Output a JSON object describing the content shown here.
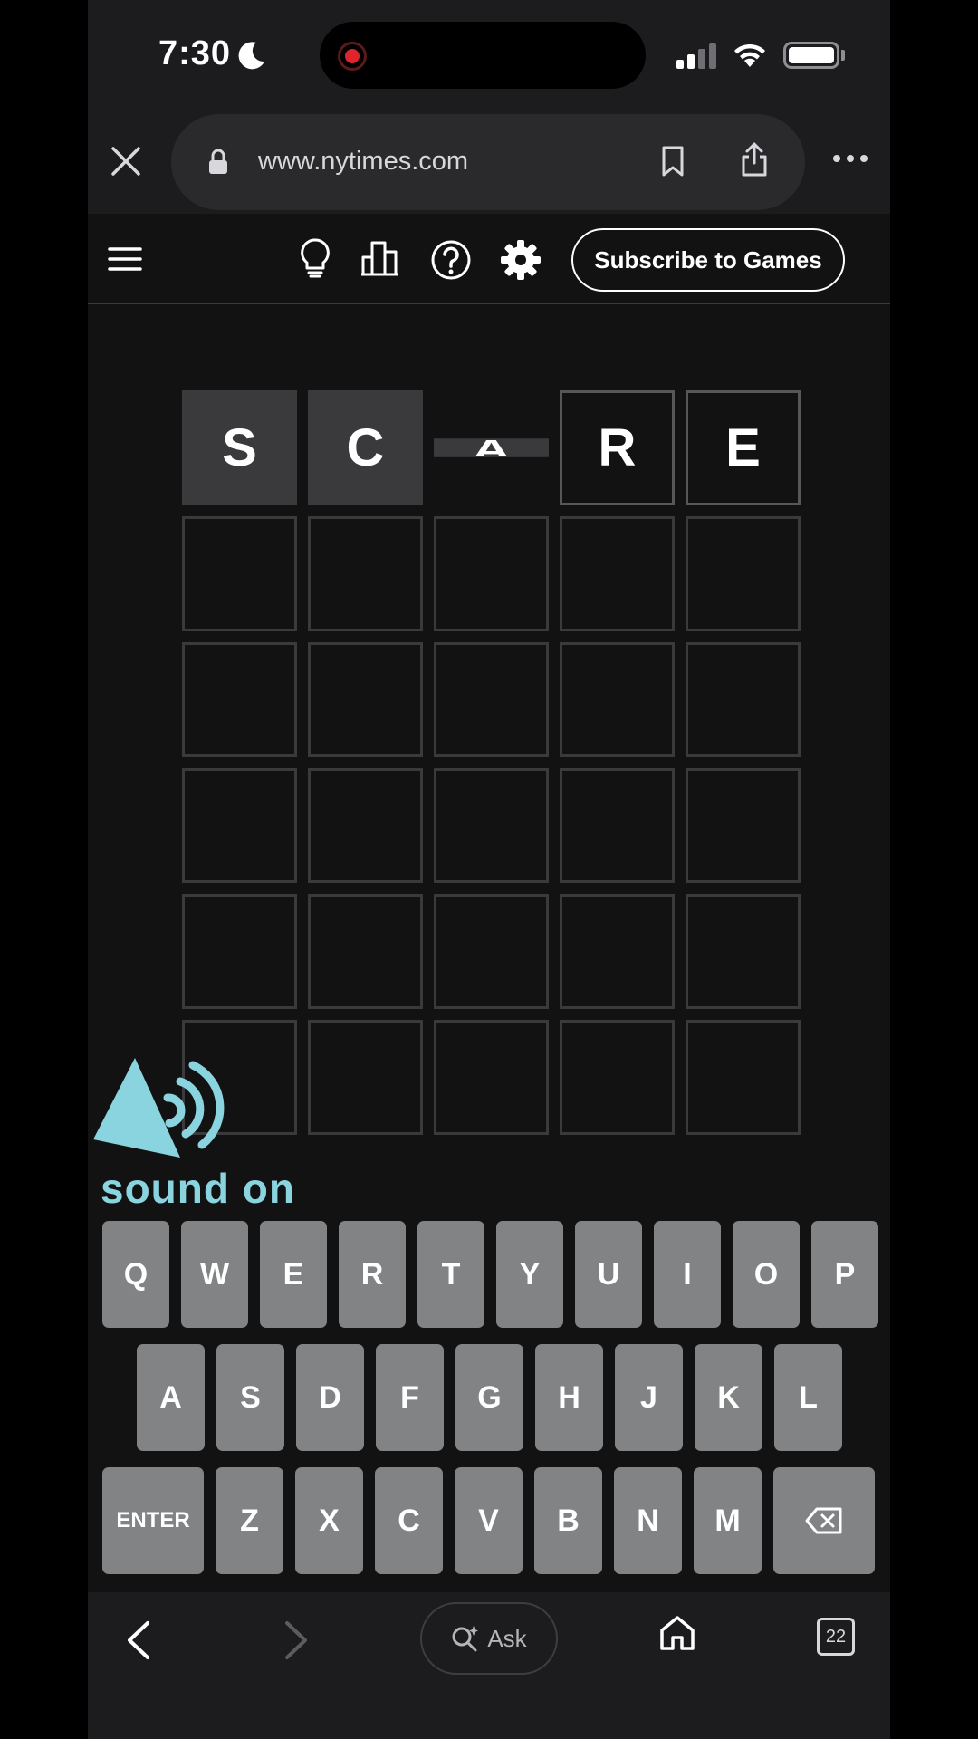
{
  "status_bar": {
    "time": "7:30"
  },
  "browser": {
    "url": "www.nytimes.com"
  },
  "game_header": {
    "subscribe_label": "Subscribe to Games"
  },
  "board": {
    "rows": [
      [
        "S",
        "C",
        "A",
        "R",
        "E"
      ],
      [
        "",
        "",
        "",
        "",
        ""
      ],
      [
        "",
        "",
        "",
        "",
        ""
      ],
      [
        "",
        "",
        "",
        "",
        ""
      ],
      [
        "",
        "",
        "",
        "",
        ""
      ],
      [
        "",
        "",
        "",
        "",
        ""
      ]
    ],
    "states": [
      [
        "absent",
        "absent",
        "flipping",
        "filled",
        "filled"
      ],
      [
        "empty",
        "empty",
        "empty",
        "empty",
        "empty"
      ],
      [
        "empty",
        "empty",
        "empty",
        "empty",
        "empty"
      ],
      [
        "empty",
        "empty",
        "empty",
        "empty",
        "empty"
      ],
      [
        "empty",
        "empty",
        "empty",
        "empty",
        "empty"
      ],
      [
        "empty",
        "empty",
        "empty",
        "empty",
        "empty"
      ]
    ]
  },
  "overlay": {
    "sound_text": "sound on"
  },
  "keyboard": {
    "rows": [
      [
        "Q",
        "W",
        "E",
        "R",
        "T",
        "Y",
        "U",
        "I",
        "O",
        "P"
      ],
      [
        "A",
        "S",
        "D",
        "F",
        "G",
        "H",
        "J",
        "K",
        "L"
      ],
      [
        "ENTER",
        "Z",
        "X",
        "C",
        "V",
        "B",
        "N",
        "M",
        "backspace-icon"
      ]
    ]
  },
  "toolbar": {
    "ask_label": "Ask",
    "tab_count": "22"
  },
  "colors": {
    "background": "#121213",
    "tile_border": "#3a3a3c",
    "absent": "#3a3a3c",
    "key": "#818384",
    "sound_overlay": "#8ad4df"
  }
}
